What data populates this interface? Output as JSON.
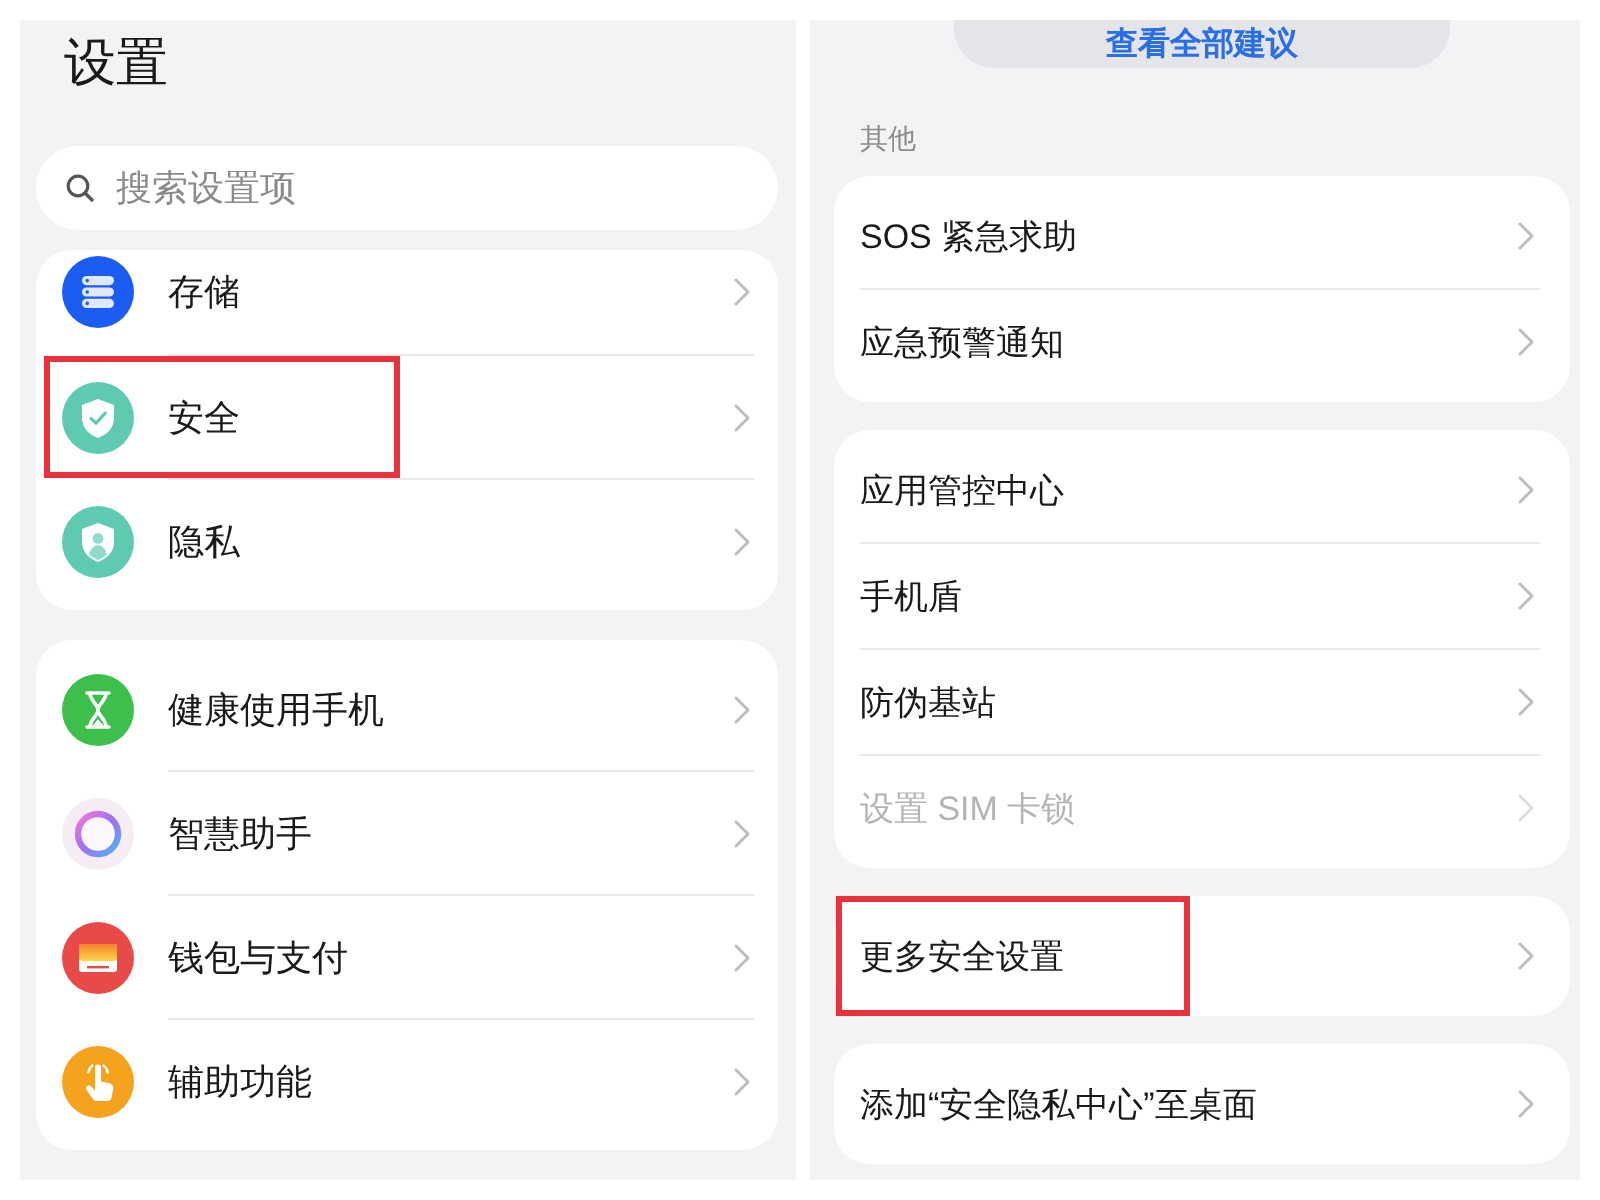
{
  "left_screen": {
    "title": "设置",
    "search": {
      "placeholder": "搜索设置项"
    },
    "groups": [
      {
        "items": [
          {
            "label": "存储",
            "highlighted": false
          },
          {
            "label": "安全",
            "highlighted": true
          },
          {
            "label": "隐私",
            "highlighted": false
          }
        ]
      },
      {
        "items": [
          {
            "label": "健康使用手机",
            "highlighted": false
          },
          {
            "label": "智慧助手",
            "highlighted": false
          },
          {
            "label": "钱包与支付",
            "highlighted": false
          },
          {
            "label": "辅助功能",
            "highlighted": false
          }
        ]
      }
    ]
  },
  "right_screen": {
    "suggestions_button": "查看全部建议",
    "section_label": "其他",
    "groups": [
      {
        "items": [
          {
            "label": "SOS 紧急求助",
            "disabled": false,
            "highlighted": false
          },
          {
            "label": "应急预警通知",
            "disabled": false,
            "highlighted": false
          }
        ]
      },
      {
        "items": [
          {
            "label": "应用管控中心",
            "disabled": false,
            "highlighted": false
          },
          {
            "label": "手机盾",
            "disabled": false,
            "highlighted": false
          },
          {
            "label": "防伪基站",
            "disabled": false,
            "highlighted": false
          },
          {
            "label": "设置 SIM 卡锁",
            "disabled": true,
            "highlighted": false
          }
        ]
      },
      {
        "items": [
          {
            "label": "更多安全设置",
            "disabled": false,
            "highlighted": true
          }
        ]
      },
      {
        "items": [
          {
            "label": "添加“安全隐私中心”至桌面",
            "disabled": false,
            "highlighted": false
          }
        ]
      }
    ]
  }
}
